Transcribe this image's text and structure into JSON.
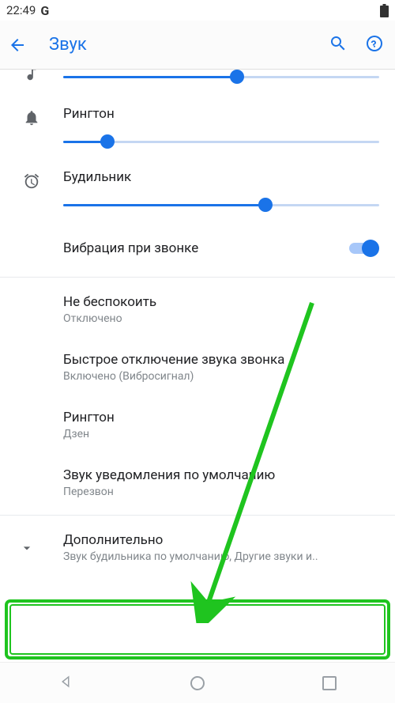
{
  "status": {
    "time": "22:49",
    "app_hint": "G"
  },
  "header": {
    "title": "Звук"
  },
  "sliders": {
    "media": {
      "label": "",
      "value": 55
    },
    "ring": {
      "label": "Рингтон",
      "value": 14
    },
    "alarm": {
      "label": "Будильник",
      "value": 64
    }
  },
  "toggle_vibrate": {
    "label": "Вибрация при звонке",
    "on": true
  },
  "items": {
    "dnd": {
      "title": "Не беспокоить",
      "sub": "Отключено"
    },
    "shortcut": {
      "title": "Быстрое отключение звука звонка",
      "sub": "Включено (Вибросигнал)"
    },
    "ringtone": {
      "title": "Рингтон",
      "sub": "Дзен"
    },
    "notif": {
      "title": "Звук уведомления по умолчанию",
      "sub": "Перезвон"
    },
    "advanced": {
      "title": "Дополнительно",
      "sub": "Звук будильника по умолчанию, Другие звуки и.."
    }
  }
}
